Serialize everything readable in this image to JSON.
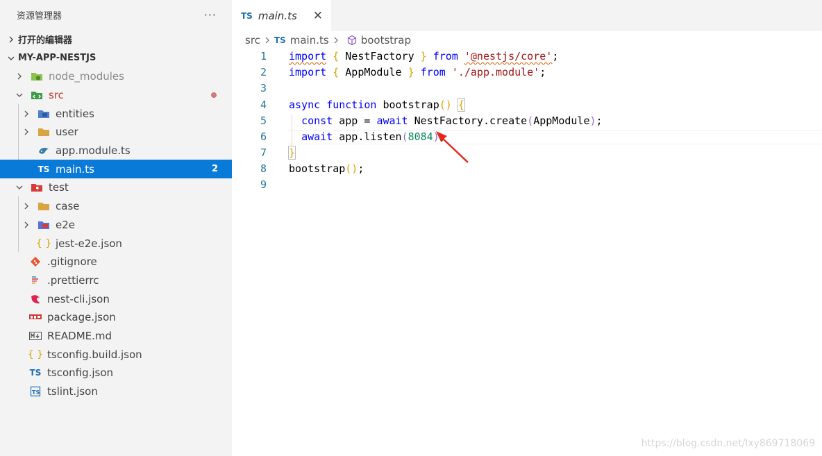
{
  "sidebar": {
    "title": "资源管理器",
    "more": "···",
    "open_editors": "打开的编辑器",
    "project": "MY-APP-NESTJS",
    "items": [
      {
        "label": "node_modules",
        "icon": "node-modules-folder-icon",
        "faded": true
      },
      {
        "label": "src",
        "icon": "src-folder-icon",
        "color": "#c0392b"
      },
      {
        "label": "entities",
        "icon": "entities-folder-icon"
      },
      {
        "label": "user",
        "icon": "folder-icon"
      },
      {
        "label": "app.module.ts",
        "icon": "nest-module-icon"
      },
      {
        "label": "main.ts",
        "icon": "typescript-file-icon",
        "badge": "2"
      },
      {
        "label": "test",
        "icon": "test-folder-icon"
      },
      {
        "label": "case",
        "icon": "folder-icon"
      },
      {
        "label": "e2e",
        "icon": "e2e-folder-icon"
      },
      {
        "label": "jest-e2e.json",
        "icon": "json-braces-icon"
      },
      {
        "label": ".gitignore",
        "icon": "git-icon"
      },
      {
        "label": ".prettierrc",
        "icon": "prettier-icon"
      },
      {
        "label": "nest-cli.json",
        "icon": "nestjs-icon"
      },
      {
        "label": "package.json",
        "icon": "npm-icon"
      },
      {
        "label": "README.md",
        "icon": "markdown-icon"
      },
      {
        "label": "tsconfig.build.json",
        "icon": "json-braces-icon"
      },
      {
        "label": "tsconfig.json",
        "icon": "typescript-config-icon"
      },
      {
        "label": "tslint.json",
        "icon": "tslint-icon"
      }
    ]
  },
  "tab": {
    "badge": "TS",
    "label": "main.ts",
    "close": "✕"
  },
  "breadcrumb": {
    "folder": "src",
    "badge": "TS",
    "file": "main.ts",
    "symbol": "bootstrap"
  },
  "code": {
    "line_numbers": [
      "1",
      "2",
      "3",
      "4",
      "5",
      "6",
      "7",
      "8",
      "9"
    ],
    "l1": {
      "kw1": "import",
      "b1": "{",
      "name": " NestFactory ",
      "b2": "}",
      "kw2": "from",
      "str": "'@nestjs/core'",
      "end": ";"
    },
    "l2": {
      "kw1": "import",
      "b1": "{",
      "name": " AppModule ",
      "b2": "}",
      "kw2": "from",
      "str": "'./app.module'",
      "end": ";"
    },
    "l4": {
      "kw1": "async",
      "kw2": "function",
      "name": " bootstrap",
      "p": "()",
      "b": "{"
    },
    "l5": {
      "kw1": "const",
      "mid": " app = ",
      "kw2": "await",
      "call": " NestFactory.create",
      "p1": "(",
      "arg": "AppModule",
      "p2": ")",
      "end": ";"
    },
    "l6": {
      "kw1": "await",
      "call": " app.listen",
      "p1": "(",
      "num": "8084",
      "p2": ")",
      "end": ";"
    },
    "l7": {
      "b": "}"
    },
    "l8": {
      "name": "bootstrap",
      "p": "()",
      "end": ";"
    }
  },
  "watermark": "https://blog.csdn.net/lxy869718069"
}
